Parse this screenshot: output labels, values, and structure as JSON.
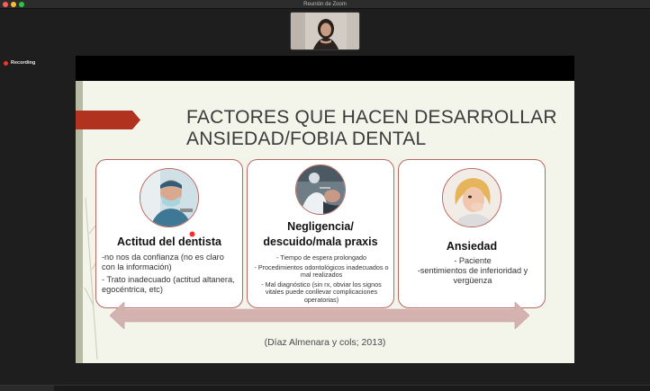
{
  "window": {
    "title": "Reunión de Zoom"
  },
  "recording": {
    "label": "Recording"
  },
  "slide": {
    "title_line1": "FACTORES QUE HACEN DESARROLLAR",
    "title_line2": "ANSIEDAD/FOBIA DENTAL",
    "cards": [
      {
        "heading": "Actitud del dentista",
        "points": [
          "-no nos da confianza (no es claro con la información)",
          "- Trato inadecuado (actitud altanera, egocéntrica, etc)"
        ]
      },
      {
        "heading_line1": "Negligencia/",
        "heading_line2": "descuido/mala praxis",
        "points": [
          "- Tiempo de espera prolongado",
          "- Procedimientos odontológicos inadecuados o mal realizados",
          "- Mal diagnóstico (sin rx, obviar los signos vitales puede conllevar complicaciones operatorias)"
        ]
      },
      {
        "heading": "Ansiedad",
        "points": [
          "- Paciente",
          "-sentimientos de inferioridad y vergüenza"
        ]
      }
    ],
    "citation": "(Díaz Almenara y cols; 2013)"
  },
  "colors": {
    "accent_red": "#b0321f",
    "card_border": "#b96660",
    "arrow_fill": "#d4b2b0",
    "slide_bg": "#f3f4ea"
  }
}
